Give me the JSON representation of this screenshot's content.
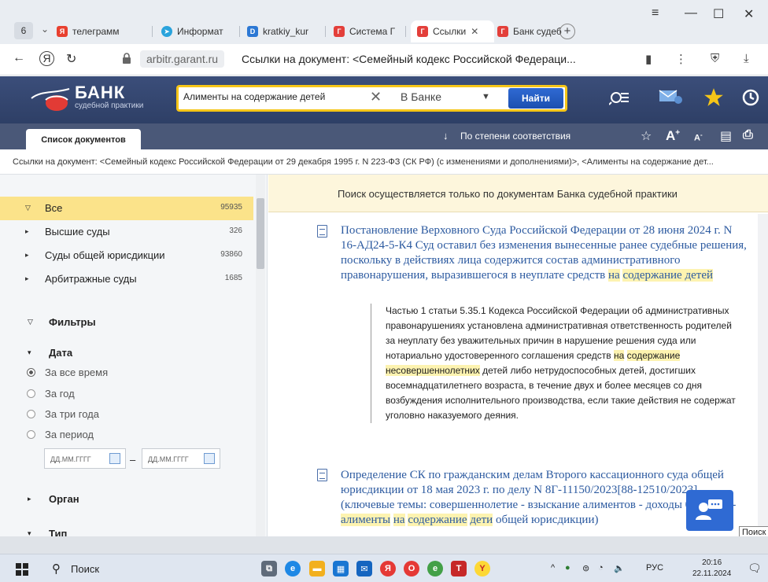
{
  "browser": {
    "tab_count": "6",
    "tabs": [
      {
        "label": "телеграмм",
        "icon": "yandex-icon"
      },
      {
        "label": "Информат",
        "icon": "telegram-icon"
      },
      {
        "label": "kratkiy_kur",
        "icon": "document-icon"
      },
      {
        "label": "Система Г",
        "icon": "garant-icon"
      },
      {
        "label": "Ссылки",
        "icon": "garant-icon",
        "active": true
      },
      {
        "label": "Банк судеб",
        "icon": "garant-icon"
      }
    ],
    "address_domain": "arbitr.garant.ru",
    "page_title": "Ссылки на документ: <Семейный кодекс Российской Федераци..."
  },
  "site": {
    "logo_title": "БАНК",
    "logo_subtitle": "судебной практики",
    "search": {
      "value": "Алименты на содержание детей",
      "scope": "В Банке",
      "submit_label": "Найти"
    }
  },
  "toolbar": {
    "list_tab_label": "Список документов",
    "sort_label": "По степени соответствия"
  },
  "breadcrumb": "Ссылки на документ: <Семейный кодекс Российской Федерации от 29 декабря 1995 г. N 223-ФЗ (СК РФ) (с изменениями и дополнениями)>, <Алименты на содержание дет...",
  "categories": [
    {
      "label": "Все",
      "count": "95935",
      "selected": true
    },
    {
      "label": "Высшие суды",
      "count": "326"
    },
    {
      "label": "Суды общей юрисдикции",
      "count": "93860"
    },
    {
      "label": "Арбитражные суды",
      "count": "1685"
    }
  ],
  "filters": {
    "header": "Фильтры",
    "date_header": "Дата",
    "date_options": [
      "За все время",
      "За год",
      "За три года",
      "За период"
    ],
    "date_placeholder": "ДД.ММ.ГГГГ",
    "organ_header": "Орган",
    "type_header": "Тип"
  },
  "results": {
    "notice": "Поиск осуществляется только по документам Банка судебной практики",
    "doc1": {
      "title_prefix": "Постановление Верховного Суда Российской Федерации от 28 июня 2024 г. N 16-АД24-5-К4 Суд оставил без изменения вынесенные ранее судебные решения, поскольку в действиях лица содержится состав административного правонарушения, выразившегося в неуплате средств ",
      "title_hl1": "на",
      "title_hl2": "содержание детей",
      "snippet_a": "Частью 1 статьи 5.35.1 Кодекса Российской Федерации об административных правонарушениях установлена административная ответственность родителей за неуплату без уважительных причин в нарушение решения суда или нотариально удостоверенного соглашения средств ",
      "snippet_hl1": "на",
      "snippet_hl2": "содержание",
      "snippet_hl3": "несовершеннолетних",
      "snippet_b": " детей либо нетрудоспособных детей, достигших восемнадцатилетнего возраста, в течение двух и более месяцев со дня возбуждения исполнительного производства, если такие действия не содержат уголовно наказуемого деяния."
    },
    "doc2": {
      "title_prefix": "Определение СК по гражданским делам Второго кассационного суда общей юрисдикции от 18 мая 2023 г. по делу N 8Г-11150/2023[88-12510/2023] (ключевые темы: совершеннолетие - взыскание алиментов - доходы бюджета - ",
      "title_hl1": "алименты",
      "title_hl2": "на",
      "title_hl3": "содержание",
      "title_hl4": "дети",
      "title_suffix": " общей юрисдикции)"
    },
    "tooltip": "Поиск"
  },
  "taskbar": {
    "search_label": "Поиск",
    "lang": "РУС",
    "time": "20:16",
    "date": "22.11.2024"
  }
}
